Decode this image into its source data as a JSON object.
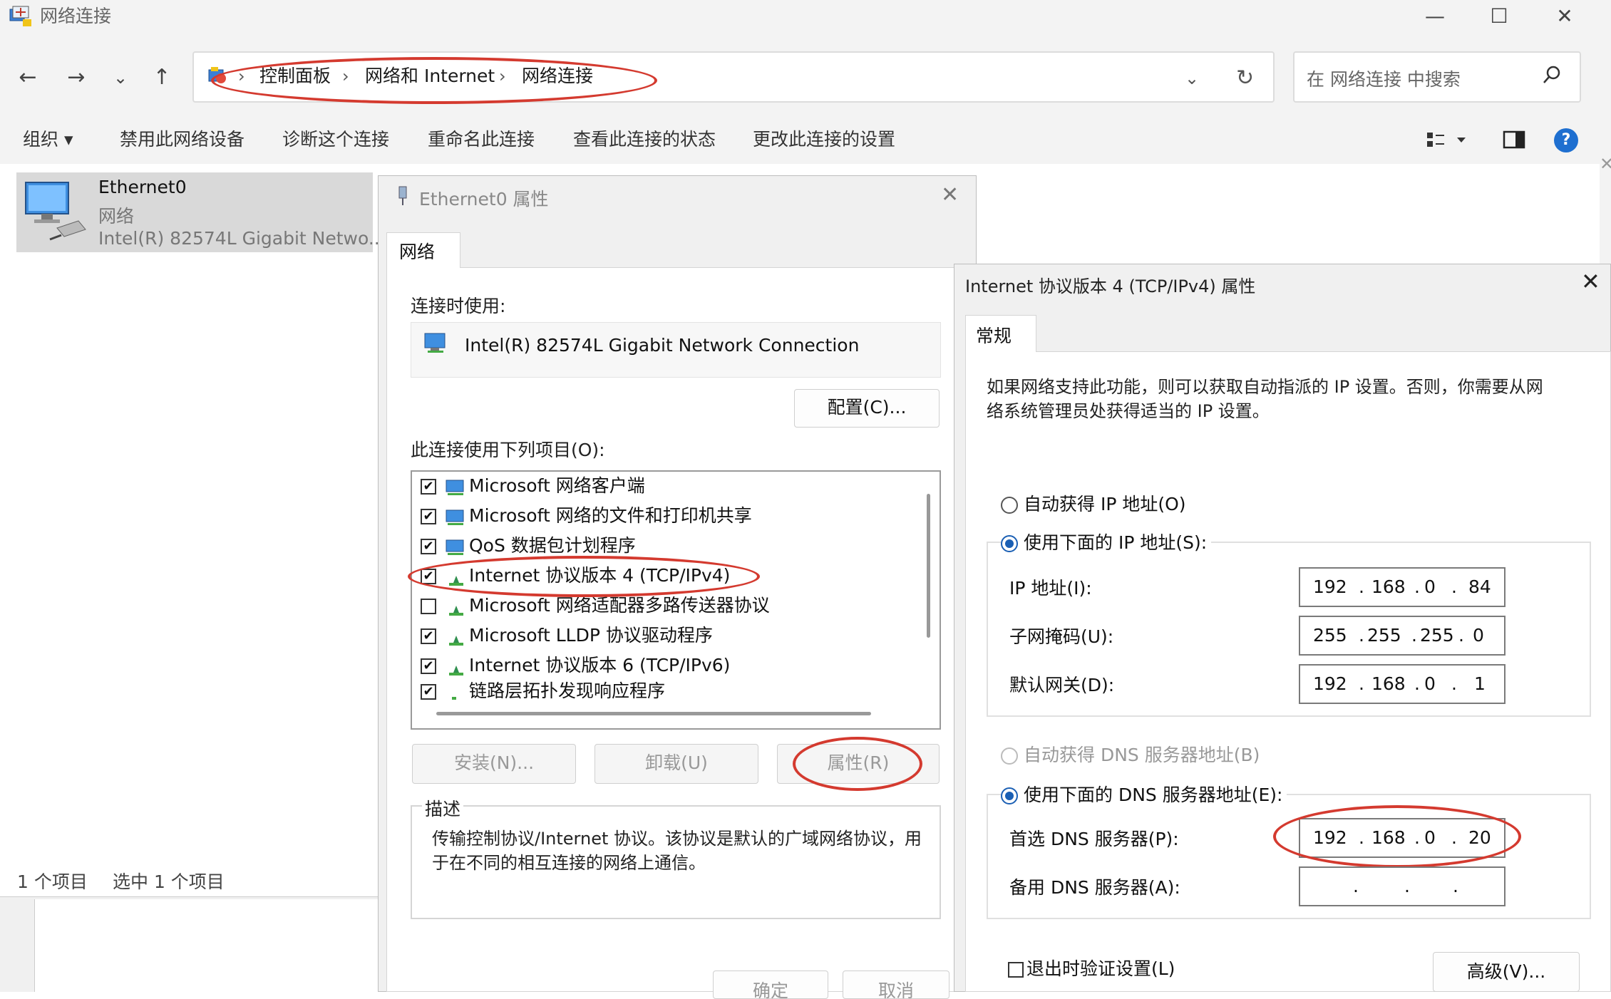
{
  "explorer": {
    "title": "网络连接",
    "nav": {
      "back": "←",
      "forward": "→",
      "recent": "⌄",
      "up": "↑"
    },
    "breadcrumb": [
      "控制面板",
      "网络和 Internet",
      "网络连接"
    ],
    "breadcrumb_sep": "›",
    "search_placeholder": "在 网络连接 中搜索",
    "commands": [
      "组织 ▾",
      "禁用此网络设备",
      "诊断这个连接",
      "重命名此连接",
      "查看此连接的状态",
      "更改此连接的设置"
    ],
    "item": {
      "name": "Ethernet0",
      "type": "网络",
      "adapter": "Intel(R) 82574L Gigabit Netwo..."
    },
    "status": {
      "count": "1 个项目",
      "selected": "选中 1 个项目"
    },
    "window_buttons": {
      "minimize": "—",
      "maximize": "☐",
      "close": "✕"
    }
  },
  "ethernet_dialog": {
    "title": "Ethernet0 属性",
    "tab": "网络",
    "connect_using_label": "连接时使用:",
    "adapter": "Intel(R) 82574L Gigabit Network Connection",
    "configure_button": "配置(C)...",
    "items_label": "此连接使用下列项目(O):",
    "items": [
      {
        "label": "Microsoft 网络客户端",
        "checked": true
      },
      {
        "label": "Microsoft 网络的文件和打印机共享",
        "checked": true
      },
      {
        "label": "QoS 数据包计划程序",
        "checked": true
      },
      {
        "label": "Internet 协议版本 4 (TCP/IPv4)",
        "checked": true
      },
      {
        "label": "Microsoft 网络适配器多路传送器协议",
        "checked": false
      },
      {
        "label": "Microsoft LLDP 协议驱动程序",
        "checked": true
      },
      {
        "label": "Internet 协议版本 6 (TCP/IPv6)",
        "checked": true
      },
      {
        "label": "链路层拓扑发现响应程序",
        "checked": true
      }
    ],
    "install_button": "安装(N)...",
    "uninstall_button": "卸载(U)",
    "properties_button": "属性(R)",
    "description_label": "描述",
    "description": "传输控制协议/Internet 协议。该协议是默认的广域网络协议，用于在不同的相互连接的网络上通信。",
    "ok_button": "确定",
    "cancel_button": "取消"
  },
  "ipv4_dialog": {
    "title": "Internet 协议版本 4 (TCP/IPv4) 属性",
    "tab": "常规",
    "info": "如果网络支持此功能，则可以获取自动指派的 IP 设置。否则，你需要从网络系统管理员处获得适当的 IP 设置。",
    "auto_ip": "自动获得 IP 地址(O)",
    "manual_ip": "使用下面的 IP 地址(S):",
    "ip_label": "IP 地址(I):",
    "ip": [
      "192",
      "168",
      "0",
      "84"
    ],
    "mask_label": "子网掩码(U):",
    "mask": [
      "255",
      "255",
      "255",
      "0"
    ],
    "gateway_label": "默认网关(D):",
    "gateway": [
      "192",
      "168",
      "0",
      "1"
    ],
    "auto_dns": "自动获得 DNS 服务器地址(B)",
    "manual_dns": "使用下面的 DNS 服务器地址(E):",
    "pref_dns_label": "首选 DNS 服务器(P):",
    "pref_dns": [
      "192",
      "168",
      "0",
      "20"
    ],
    "alt_dns_label": "备用 DNS 服务器(A):",
    "alt_dns": [
      "",
      "",
      "",
      ""
    ],
    "validate": "退出时验证设置(L)",
    "advanced_button": "高级(V)...",
    "close": "✕"
  },
  "colors": {
    "annotation": "#d43a2f",
    "radio_selected": "#1a5fb4",
    "help": "#1e6fd0"
  }
}
